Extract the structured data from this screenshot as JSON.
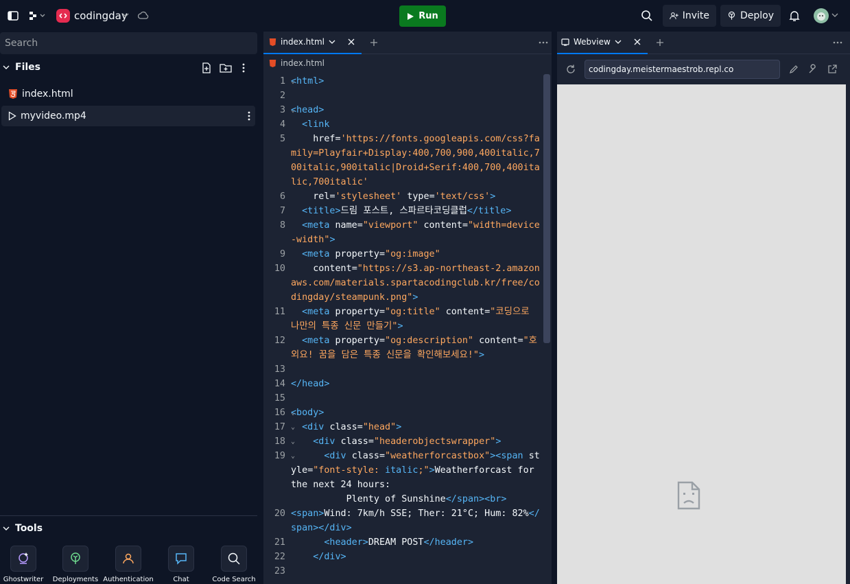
{
  "topbar": {
    "project_name": "codingday",
    "run_label": "Run",
    "invite_label": "Invite",
    "deploy_label": "Deploy"
  },
  "sidebar": {
    "search_placeholder": "Search",
    "files_title": "Files",
    "files": [
      {
        "name": "index.html",
        "icon": "html5-icon"
      },
      {
        "name": "myvideo.mp4",
        "icon": "play-icon"
      }
    ],
    "tools_title": "Tools",
    "tools": [
      {
        "label": "Ghostwriter",
        "icon": "ghostwriter-icon"
      },
      {
        "label": "Deployments",
        "icon": "deployments-icon"
      },
      {
        "label": "Authentication",
        "icon": "user-icon"
      },
      {
        "label": "Chat",
        "icon": "chat-icon"
      },
      {
        "label": "Code Search",
        "icon": "search-icon"
      }
    ]
  },
  "editor": {
    "tab_label": "index.html",
    "breadcrumb": "index.html",
    "lines": [
      {
        "n": "1",
        "fold": true,
        "html": "<span class='t'>&lt;html&gt;</span>"
      },
      {
        "n": "2",
        "fold": false,
        "html": ""
      },
      {
        "n": "3",
        "fold": true,
        "html": "<span class='t'>&lt;head&gt;</span>"
      },
      {
        "n": "4",
        "fold": false,
        "html": "  <span class='t'>&lt;link</span>"
      },
      {
        "n": "5",
        "fold": false,
        "html": "    <span class='a'>href</span>=<span class='s'>'https://fonts.googleapis.com/css?family=Playfair+Display:400,700,900,400italic,700italic,900italic|Droid+Serif:400,700,400italic,700italic'</span>"
      },
      {
        "n": "6",
        "fold": false,
        "html": "    <span class='a'>rel</span>=<span class='s'>'stylesheet'</span> <span class='a'>type</span>=<span class='s'>'text/css'</span><span class='t'>&gt;</span>"
      },
      {
        "n": "7",
        "fold": false,
        "html": "  <span class='t'>&lt;title&gt;</span>드림 포스트, 스파르타코딩클럽<span class='t'>&lt;/title&gt;</span>"
      },
      {
        "n": "8",
        "fold": false,
        "html": "  <span class='t'>&lt;meta</span> <span class='a'>name</span>=<span class='s'>\"viewport\"</span> <span class='a'>content</span>=<span class='s'>\"width=device-width\"</span><span class='t'>&gt;</span>"
      },
      {
        "n": "9",
        "fold": false,
        "html": "  <span class='t'>&lt;meta</span> <span class='a'>property</span>=<span class='s'>\"og:image\"</span>"
      },
      {
        "n": "10",
        "fold": false,
        "html": "    <span class='a'>content</span>=<span class='s'>\"https://s3.ap-northeast-2.amazonaws.com/materials.spartacodingclub.kr/free/codingday/steampunk.png\"</span><span class='t'>&gt;</span>"
      },
      {
        "n": "11",
        "fold": false,
        "html": "  <span class='t'>&lt;meta</span> <span class='a'>property</span>=<span class='s'>\"og:title\"</span> <span class='a'>content</span>=<span class='s'>\"코딩으로 나만의 특종 신문 만들기\"</span><span class='t'>&gt;</span>"
      },
      {
        "n": "12",
        "fold": false,
        "html": "  <span class='t'>&lt;meta</span> <span class='a'>property</span>=<span class='s'>\"og:description\"</span> <span class='a'>content</span>=<span class='s'>\"호외요! 꿈을 담은 특종 신문을 확인해보세요!\"</span><span class='t'>&gt;</span>"
      },
      {
        "n": "13",
        "fold": false,
        "html": ""
      },
      {
        "n": "14",
        "fold": false,
        "html": "<span class='t'>&lt;/head&gt;</span>"
      },
      {
        "n": "15",
        "fold": false,
        "html": ""
      },
      {
        "n": "16",
        "fold": true,
        "html": "<span class='t'>&lt;body&gt;</span>"
      },
      {
        "n": "17",
        "fold": true,
        "html": "  <span class='t'>&lt;div</span> <span class='a'>class</span>=<span class='s'>\"head\"</span><span class='t'>&gt;</span>"
      },
      {
        "n": "18",
        "fold": true,
        "html": "    <span class='t'>&lt;div</span> <span class='a'>class</span>=<span class='s'>\"headerobjectswrapper\"</span><span class='t'>&gt;</span>"
      },
      {
        "n": "19",
        "fold": true,
        "html": "      <span class='t'>&lt;div</span> <span class='a'>class</span>=<span class='s'>\"weatherforcastbox\"</span><span class='t'>&gt;&lt;span</span> <span class='a'>style</span>=<span class='s'>\"font-style: </span><span class='t'>italic</span><span class='s'>;\"</span><span class='t'>&gt;</span>Weatherforcast for the next 24 hours:"
      },
      {
        "n": "",
        "fold": false,
        "html": "          Plenty of Sunshine<span class='t'>&lt;/span&gt;&lt;br&gt;</span>"
      },
      {
        "n": "20",
        "fold": false,
        "html": "<span class='t'>&lt;span&gt;</span>Wind: 7km/h SSE; Ther: 21°C; Hum: 82%<span class='t'>&lt;/span&gt;&lt;/div&gt;</span>"
      },
      {
        "n": "21",
        "fold": false,
        "html": "      <span class='t'>&lt;header&gt;</span>DREAM POST<span class='t'>&lt;/header&gt;</span>"
      },
      {
        "n": "22",
        "fold": false,
        "html": "    <span class='t'>&lt;/div&gt;</span>"
      },
      {
        "n": "23",
        "fold": false,
        "html": ""
      }
    ]
  },
  "webview": {
    "tab_label": "Webview",
    "url": "codingday.meistermaestrob.repl.co"
  }
}
